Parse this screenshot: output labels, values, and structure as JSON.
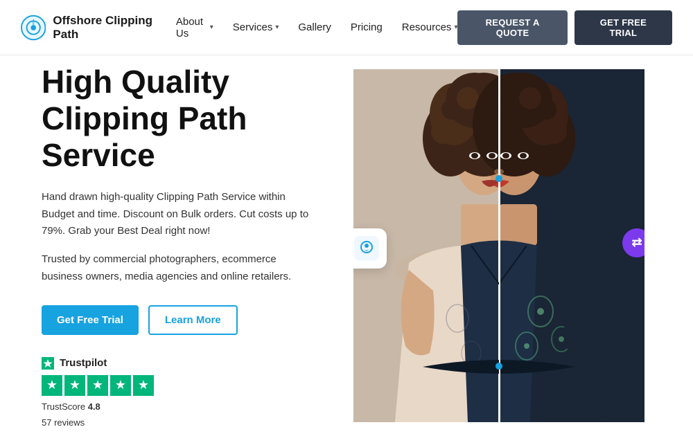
{
  "brand": {
    "name": "Offshore Clipping Path",
    "logo_alt": "Offshore Clipping Path Logo"
  },
  "navbar": {
    "links": [
      {
        "label": "About Us",
        "has_dropdown": true
      },
      {
        "label": "Services",
        "has_dropdown": true
      },
      {
        "label": "Gallery",
        "has_dropdown": false
      },
      {
        "label": "Pricing",
        "has_dropdown": false
      },
      {
        "label": "Resources",
        "has_dropdown": true
      }
    ],
    "cta_quote": "REQUEST A QUOTE",
    "cta_trial": "GET FREE TRIAL"
  },
  "hero": {
    "title_line1": "High Quality",
    "title_line2": "Clipping Path Service",
    "description": "Hand drawn high-quality Clipping Path Service within Budget and time. Discount on Bulk orders. Cut costs up to 79%. Grab your Best Deal right now!",
    "trusted_text": "Trusted by commercial photographers, ecommerce business owners, media agencies and online retailers.",
    "btn_trial": "Get Free Trial",
    "btn_learn": "Learn More"
  },
  "trustpilot": {
    "label": "Trustpilot",
    "score_label": "TrustScore",
    "score": "4.8",
    "reviews": "57 reviews"
  }
}
